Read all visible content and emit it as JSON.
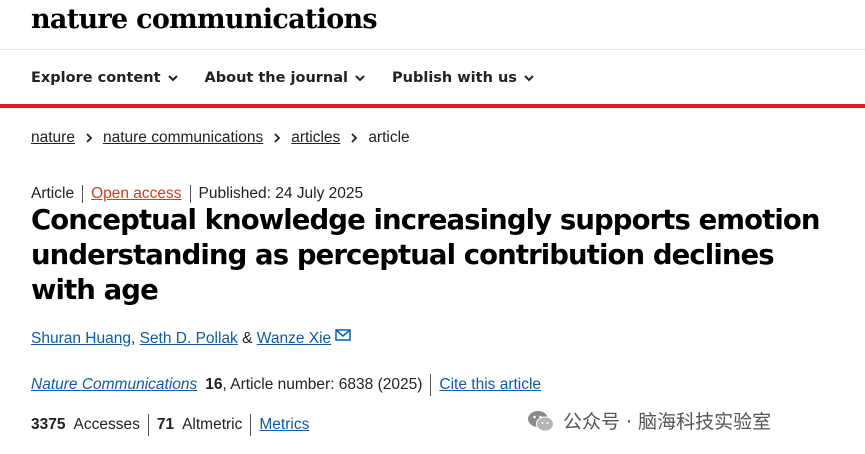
{
  "site": {
    "logo": "nature communications"
  },
  "nav": {
    "items": [
      {
        "label": "Explore content"
      },
      {
        "label": "About the journal"
      },
      {
        "label": "Publish with us"
      }
    ]
  },
  "breadcrumb": {
    "items": [
      "nature",
      "nature communications",
      "articles"
    ],
    "current": "article"
  },
  "article": {
    "type": "Article",
    "access": "Open access",
    "published": "Published: 24 July 2025",
    "title": "Conceptual knowledge increasingly supports emotion understanding as perceptual contribution declines with age",
    "authors": [
      "Shuran Huang",
      "Seth D. Pollak",
      "Wanze Xie"
    ],
    "author_sep_1": ",",
    "author_sep_2": "&",
    "journal": "Nature Communications",
    "volume": "16",
    "article_number": ", Article number: 6838 (2025)",
    "cite_label": "Cite this article"
  },
  "metrics": {
    "accesses_count": "3375",
    "accesses_label": "Accesses",
    "altmetric_count": "71",
    "altmetric_label": "Altmetric",
    "metrics_link": "Metrics"
  },
  "watermark": {
    "text": "公众号 · 脑海科技实验室"
  },
  "colors": {
    "accent_red": "#e01c24",
    "link_blue": "#0c5da5",
    "open_access": "#c8451c"
  }
}
